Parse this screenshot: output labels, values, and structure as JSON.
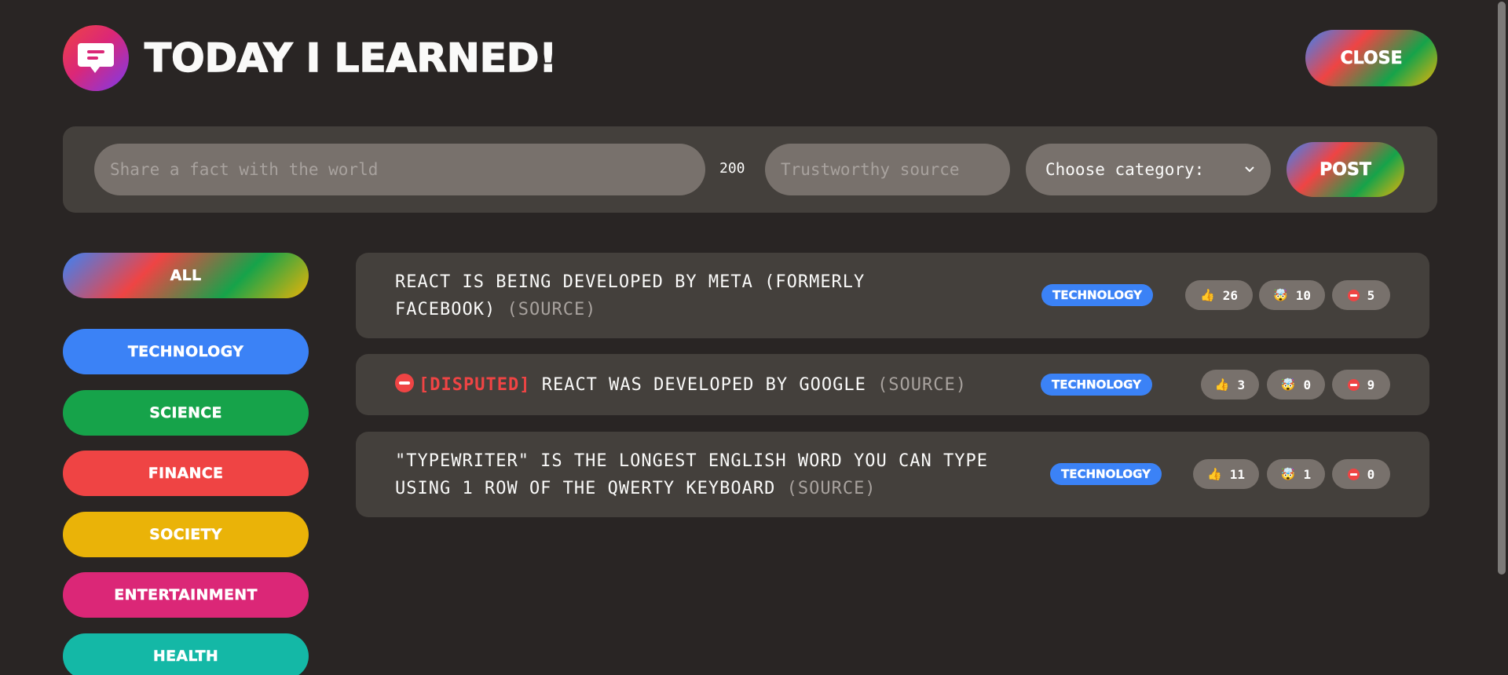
{
  "header": {
    "title": "Today I Learned!",
    "close_label": "Close"
  },
  "form": {
    "fact_placeholder": "Share a fact with the world",
    "char_count": "200",
    "source_placeholder": "Trustworthy source",
    "category_selected": "Choose category:",
    "post_label": "Post"
  },
  "categories": [
    {
      "label": "All",
      "color": "gradient"
    },
    {
      "label": "Technology",
      "color": "#3b82f6"
    },
    {
      "label": "Science",
      "color": "#16a34a"
    },
    {
      "label": "Finance",
      "color": "#ef4444"
    },
    {
      "label": "Society",
      "color": "#eab308"
    },
    {
      "label": "Entertainment",
      "color": "#db2777"
    },
    {
      "label": "Health",
      "color": "#14b8a6"
    }
  ],
  "facts": [
    {
      "text": "React is being developed by Meta (formerly facebook)",
      "source": "(Source)",
      "disputed": "",
      "category": "Technology",
      "votes_interesting": "26",
      "votes_mindblowing": "10",
      "votes_false": "5"
    },
    {
      "text": "React was developed by Google",
      "source": "(Source)",
      "disputed": "[DISPUTED]",
      "category": "Technology",
      "votes_interesting": "3",
      "votes_mindblowing": "0",
      "votes_false": "9"
    },
    {
      "text": "\"Typewriter\" is the longest English word you can type using 1 row of the QWERTY keyboard",
      "source": "(Source)",
      "disputed": "",
      "category": "Technology",
      "votes_interesting": "11",
      "votes_mindblowing": "1",
      "votes_false": "0"
    }
  ],
  "icons": {
    "logo": "speech-bubble-icon",
    "interesting": "👍",
    "mindblowing": "🤯",
    "false": "stop-sign-icon"
  }
}
